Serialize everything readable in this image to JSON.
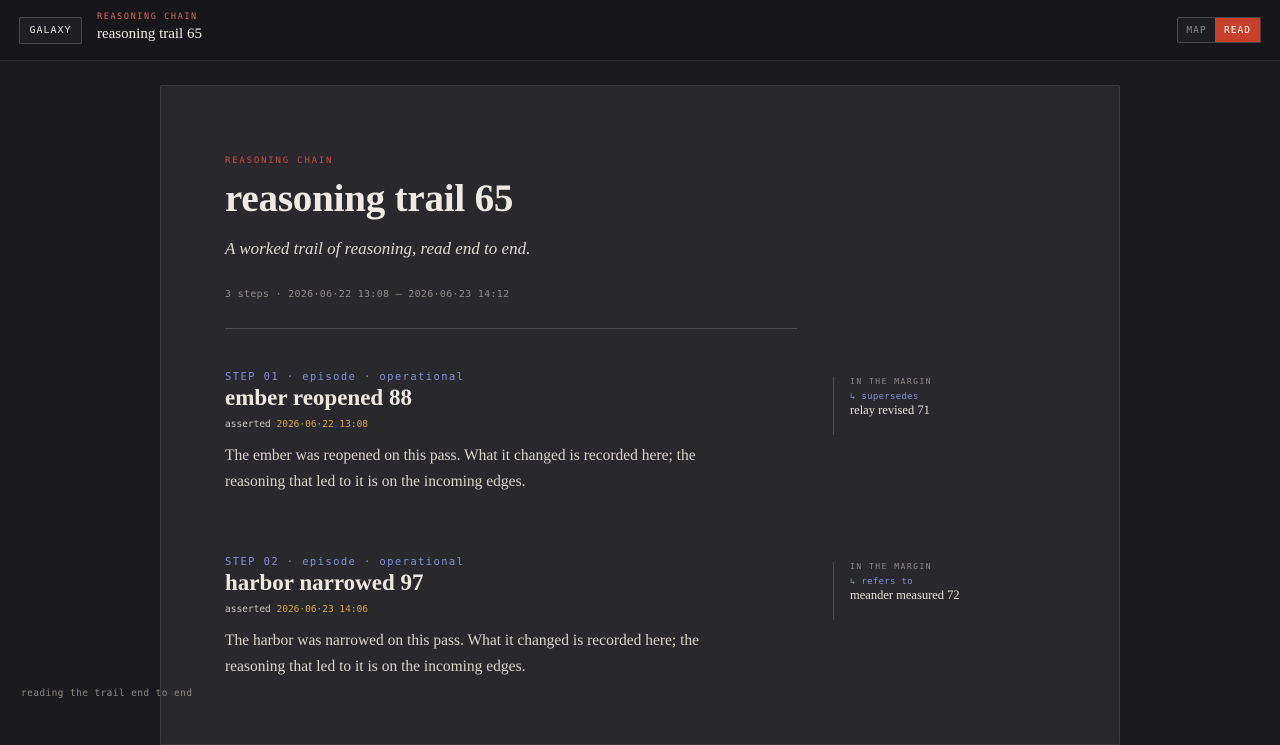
{
  "header": {
    "galaxy_label": "GALAXY",
    "eyebrow": "REASONING CHAIN",
    "title": "reasoning trail 65",
    "modes": {
      "map": "MAP",
      "read": "READ",
      "active": "read"
    }
  },
  "card": {
    "eyebrow": "REASONING CHAIN",
    "title": "reasoning trail 65",
    "subtitle": "A worked trail of reasoning, read end to end.",
    "meta": "3 steps · 2026·06·22 13:08 — 2026·06·23 14:12"
  },
  "steps": [
    {
      "kicker": "STEP 01 · episode · operational",
      "title": "ember reopened 88",
      "assert_label": "asserted",
      "assert_date": "2026·06·22 13:08",
      "body": "The ember was reopened on this pass. What it changed is recorded here; the reasoning that led to it is on the incoming edges.",
      "margin": {
        "eyebrow": "IN THE MARGIN",
        "relation": "↳ supersedes",
        "target": "relay revised 71"
      }
    },
    {
      "kicker": "STEP 02 · episode · operational",
      "title": "harbor narrowed 97",
      "assert_label": "asserted",
      "assert_date": "2026·06·23 14:06",
      "body": "The harbor was narrowed on this pass. What it changed is recorded here; the reasoning that led to it is on the incoming edges.",
      "margin": {
        "eyebrow": "IN THE MARGIN",
        "relation": "↳ refers to",
        "target": "meander measured 72"
      }
    }
  ],
  "footer": {
    "status": "reading the trail end to end"
  },
  "colors": {
    "accent_red": "#c7402b",
    "link_blue": "#7d8ed6",
    "date_amber": "#d4a043",
    "background": "#1b1b1f",
    "card": "#29282d"
  }
}
